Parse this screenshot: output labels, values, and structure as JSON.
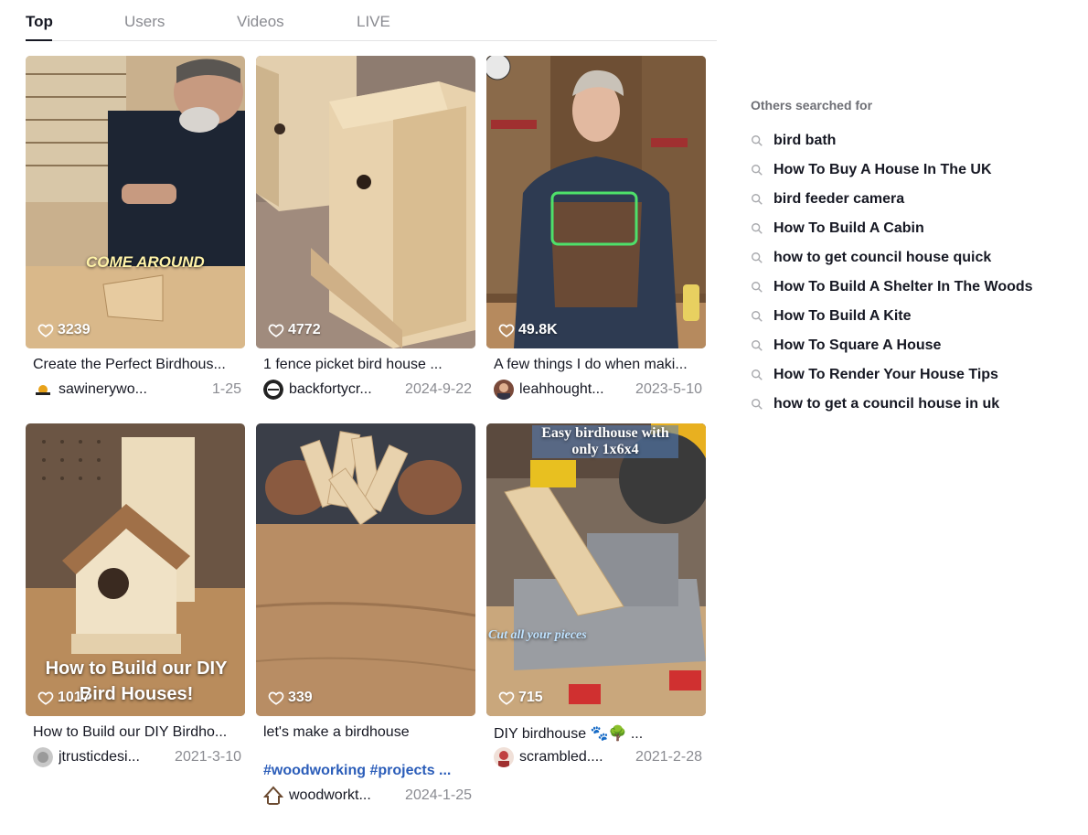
{
  "tabs": [
    {
      "label": "Top",
      "active": true
    },
    {
      "label": "Users",
      "active": false
    },
    {
      "label": "Videos",
      "active": false
    },
    {
      "label": "LIVE",
      "active": false
    }
  ],
  "videos": [
    {
      "likes": "3239",
      "description": "Create the Perfect Birdhous...",
      "author": "sawinerywo...",
      "date": "1-25",
      "overlay": "COME AROUND"
    },
    {
      "likes": "4772",
      "description": "1 fence picket bird house ...",
      "author": "backfortycr...",
      "date": "2024-9-22"
    },
    {
      "likes": "49.8K",
      "description": "A few things I do when maki...",
      "author": "leahhought...",
      "date": "2023-5-10"
    },
    {
      "likes": "1017",
      "description": "How to Build our DIY Birdho...",
      "author": "jtrusticdesi...",
      "date": "2021-3-10",
      "overlay": "How to Build our DIY Bird Houses!"
    },
    {
      "likes": "339",
      "description": "let's make a birdhouse",
      "hashtags": "#woodworking #projects ...",
      "author": "woodworkt...",
      "date": "2024-1-25"
    },
    {
      "likes": "715",
      "description": "DIY birdhouse 🐾🌳 ...",
      "author": "scrambled....",
      "date": "2021-2-28",
      "overlay": "Easy birdhouse with only 1x6x4",
      "overlay2": "Cut all your pieces"
    }
  ],
  "sidebar": {
    "title": "Others searched for",
    "items": [
      "bird bath",
      "How To Buy A House In The UK",
      "bird feeder camera",
      "How To Build A Cabin",
      "how to get council house quick",
      "How To Build A Shelter In The Woods",
      "How To Build A Kite",
      "How To Square A House",
      "How To Render Your House Tips",
      "how to get a council house in uk"
    ]
  },
  "colors": {
    "accent": "#161823",
    "muted": "#8a8b91",
    "hashtag": "#2b5db9"
  }
}
